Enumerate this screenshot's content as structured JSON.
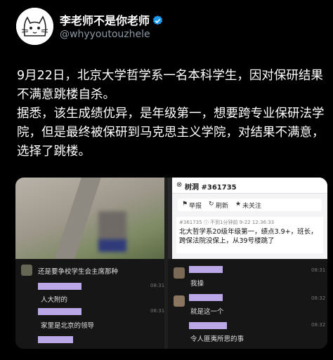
{
  "author": {
    "display_name": "李老师不是你老师",
    "handle": "@whyyoutouzhele",
    "avatar_icon": "cat-sketch-avatar",
    "verified_icon": "verified-badge-icon",
    "verified_color": "#1d9bf0"
  },
  "tweet": {
    "paragraph1": "9月22日，北京大学哲学系一名本科学生，因对保研结果不满意跳楼自杀。",
    "paragraph2": "据悉，该生成绩优异，是年级第一，想要跨专业保研法学院，但是最终被保研到马克思主义学院，对结果不满意，选择了跳楼。"
  },
  "forum": {
    "title": "树洞 #361735",
    "actions": [
      "举报",
      "刷新",
      "未关注"
    ],
    "post_meta": "#361735  ⓘ 不到1分钟前  9-22 12:36:33",
    "post_body": "北大哲学系20级年级第一，绩点3.9+，班长，跨保法院没保上，从39号楼跳了"
  },
  "chat_left": [
    {
      "text": "还是要争校学生会主席那种",
      "time": ""
    },
    {
      "text": "人大附的",
      "time": "08:31"
    },
    {
      "text": "家里是北京的领导",
      "time": "08:31"
    }
  ],
  "chat_right": [
    {
      "text": "我操",
      "time": "08:31"
    },
    {
      "text": "就是这一个",
      "time": "08:32"
    },
    {
      "text": "令人匪夷所思的事",
      "time": "08:32"
    }
  ]
}
